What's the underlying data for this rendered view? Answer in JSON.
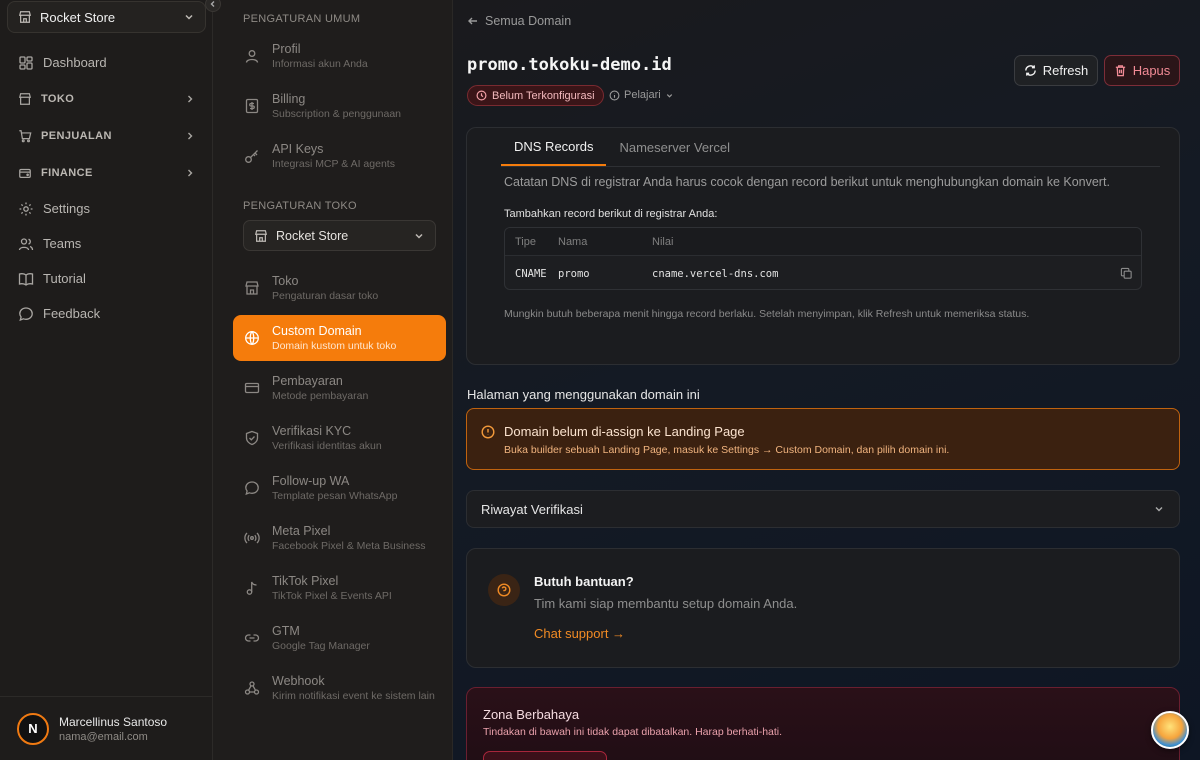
{
  "sidebar": {
    "store_name": "Rocket Store",
    "items": [
      {
        "label": "Dashboard",
        "icon": "grid-icon",
        "group": false
      },
      {
        "label": "TOKO",
        "icon": "store-icon",
        "group": true
      },
      {
        "label": "PENJUALAN",
        "icon": "cart-icon",
        "group": true
      },
      {
        "label": "FINANCE",
        "icon": "wallet-icon",
        "group": true
      },
      {
        "label": "Settings",
        "icon": "gear-icon",
        "group": false
      },
      {
        "label": "Teams",
        "icon": "users-icon",
        "group": false
      },
      {
        "label": "Tutorial",
        "icon": "book-icon",
        "group": false
      },
      {
        "label": "Feedback",
        "icon": "chat-icon",
        "group": false
      }
    ],
    "user": {
      "initial": "N",
      "name": "Marcellinus Santoso",
      "email": "nama@email.com"
    }
  },
  "settings": {
    "general_title": "PENGATURAN UMUM",
    "general": [
      {
        "title": "Profil",
        "subtitle": "Informasi akun Anda"
      },
      {
        "title": "Billing",
        "subtitle": "Subscription & penggunaan"
      },
      {
        "title": "API Keys",
        "subtitle": "Integrasi MCP & AI agents"
      }
    ],
    "store_title": "PENGATURAN TOKO",
    "store_select": "Rocket Store",
    "store": [
      {
        "title": "Toko",
        "subtitle": "Pengaturan dasar toko"
      },
      {
        "title": "Custom Domain",
        "subtitle": "Domain kustom untuk toko"
      },
      {
        "title": "Pembayaran",
        "subtitle": "Metode pembayaran"
      },
      {
        "title": "Verifikasi KYC",
        "subtitle": "Verifikasi identitas akun"
      },
      {
        "title": "Follow-up WA",
        "subtitle": "Template pesan WhatsApp"
      },
      {
        "title": "Meta Pixel",
        "subtitle": "Facebook Pixel & Meta Business"
      },
      {
        "title": "TikTok Pixel",
        "subtitle": "TikTok Pixel & Events API"
      },
      {
        "title": "GTM",
        "subtitle": "Google Tag Manager"
      },
      {
        "title": "Webhook",
        "subtitle": "Kirim notifikasi event ke sistem lain"
      }
    ]
  },
  "main": {
    "back_label": "Semua Domain",
    "domain": "promo.tokoku-demo.id",
    "status_badge": "Belum Terkonfigurasi",
    "learn_label": "Pelajari",
    "refresh_label": "Refresh",
    "delete_label": "Hapus",
    "tabs": [
      "DNS Records",
      "Nameserver Vercel"
    ],
    "dns": {
      "description": "Catatan DNS di registrar Anda harus cocok dengan record berikut untuk menghubungkan domain ke Konvert.",
      "subtitle": "Tambahkan record berikut di registrar Anda:",
      "headers": [
        "Tipe",
        "Nama",
        "Nilai"
      ],
      "rows": [
        {
          "type": "CNAME",
          "name": "promo",
          "value": "cname.vercel-dns.com"
        }
      ],
      "note": "Mungkin butuh beberapa menit hingga record berlaku. Setelah menyimpan, klik Refresh untuk memeriksa status."
    },
    "pages_title": "Halaman yang menggunakan domain ini",
    "warning": {
      "title": "Domain belum di-assign ke Landing Page",
      "text": "Buka builder sebuah Landing Page, masuk ke Settings → Custom Domain, dan pilih domain ini."
    },
    "history_label": "Riwayat Verifikasi",
    "help": {
      "title": "Butuh bantuan?",
      "text": "Tim kami siap membantu setup domain Anda.",
      "link": "Chat support →"
    },
    "danger": {
      "title": "Zona Berbahaya",
      "text": "Tindakan di bawah ini tidak dapat dibatalkan. Harap berhati-hati."
    }
  },
  "colors": {
    "accent": "#f57c0c",
    "danger": "#f28b96",
    "warning_border": "#c0630f"
  }
}
